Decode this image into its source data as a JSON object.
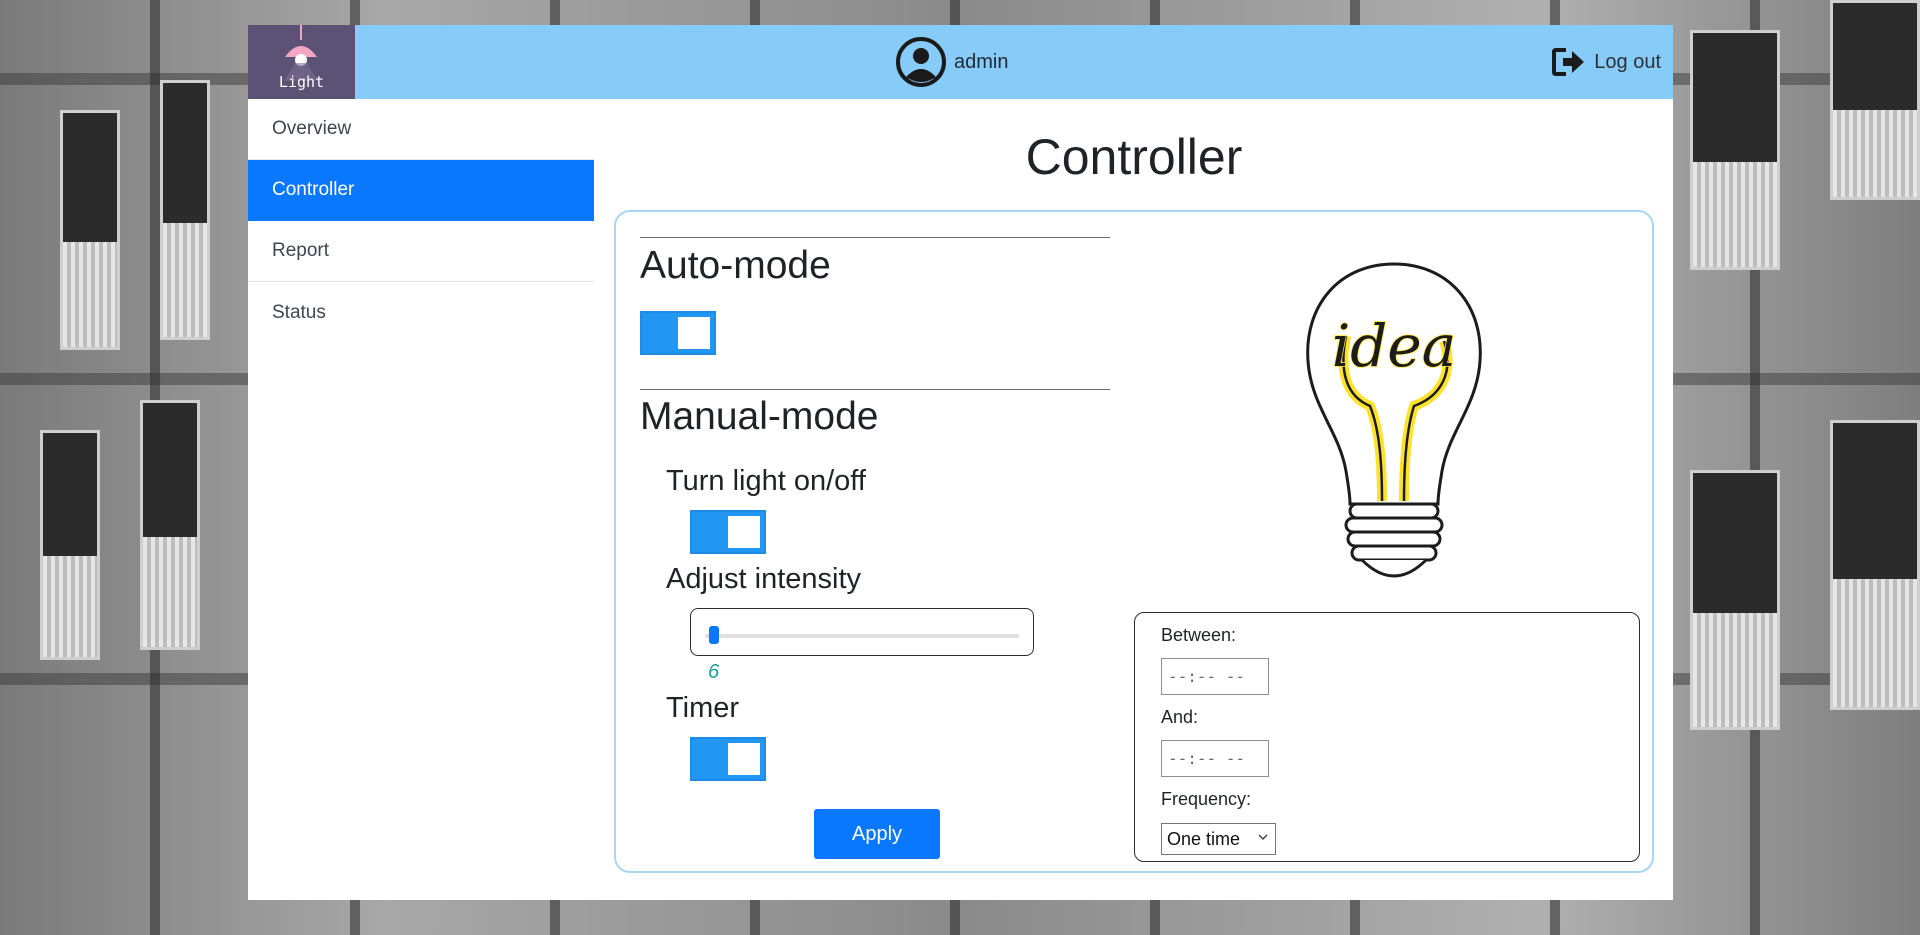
{
  "header": {
    "logo_text": "Light",
    "username": "admin",
    "logout_label": "Log out",
    "bar_color": "#87cbf8",
    "logo_color": "#5c5276"
  },
  "sidebar": {
    "items": [
      {
        "label": "Overview",
        "active": false
      },
      {
        "label": "Controller",
        "active": true
      },
      {
        "label": "Report",
        "active": false
      },
      {
        "label": "Status",
        "active": false
      }
    ],
    "active_color": "#0a78fe"
  },
  "main": {
    "title": "Controller",
    "auto_mode": {
      "heading": "Auto-mode",
      "on": true
    },
    "manual_mode": {
      "heading": "Manual-mode",
      "light_label": "Turn light on/off",
      "light_on": true,
      "intensity_label": "Adjust intensity",
      "intensity_value": "6",
      "timer_label": "Timer",
      "timer_on": true
    },
    "apply_label": "Apply",
    "bulb_word": "idea",
    "timer_panel": {
      "between_label": "Between:",
      "between_value": "--:--  --",
      "and_label": "And:",
      "and_value": "--:--  --",
      "frequency_label": "Frequency:",
      "frequency_value": "One time"
    }
  },
  "icons": {
    "avatar": "user-circle-icon",
    "logout": "sign-out-icon",
    "lamp": "lamp-icon",
    "bulb": "lightbulb-icon",
    "dropdown": "chevron-down-icon"
  },
  "colors": {
    "toggle_on": "#2196f3",
    "apply_button": "#0a78fe",
    "intensity_value": "#1aa39a",
    "bulb_highlight": "#ffe22b"
  }
}
